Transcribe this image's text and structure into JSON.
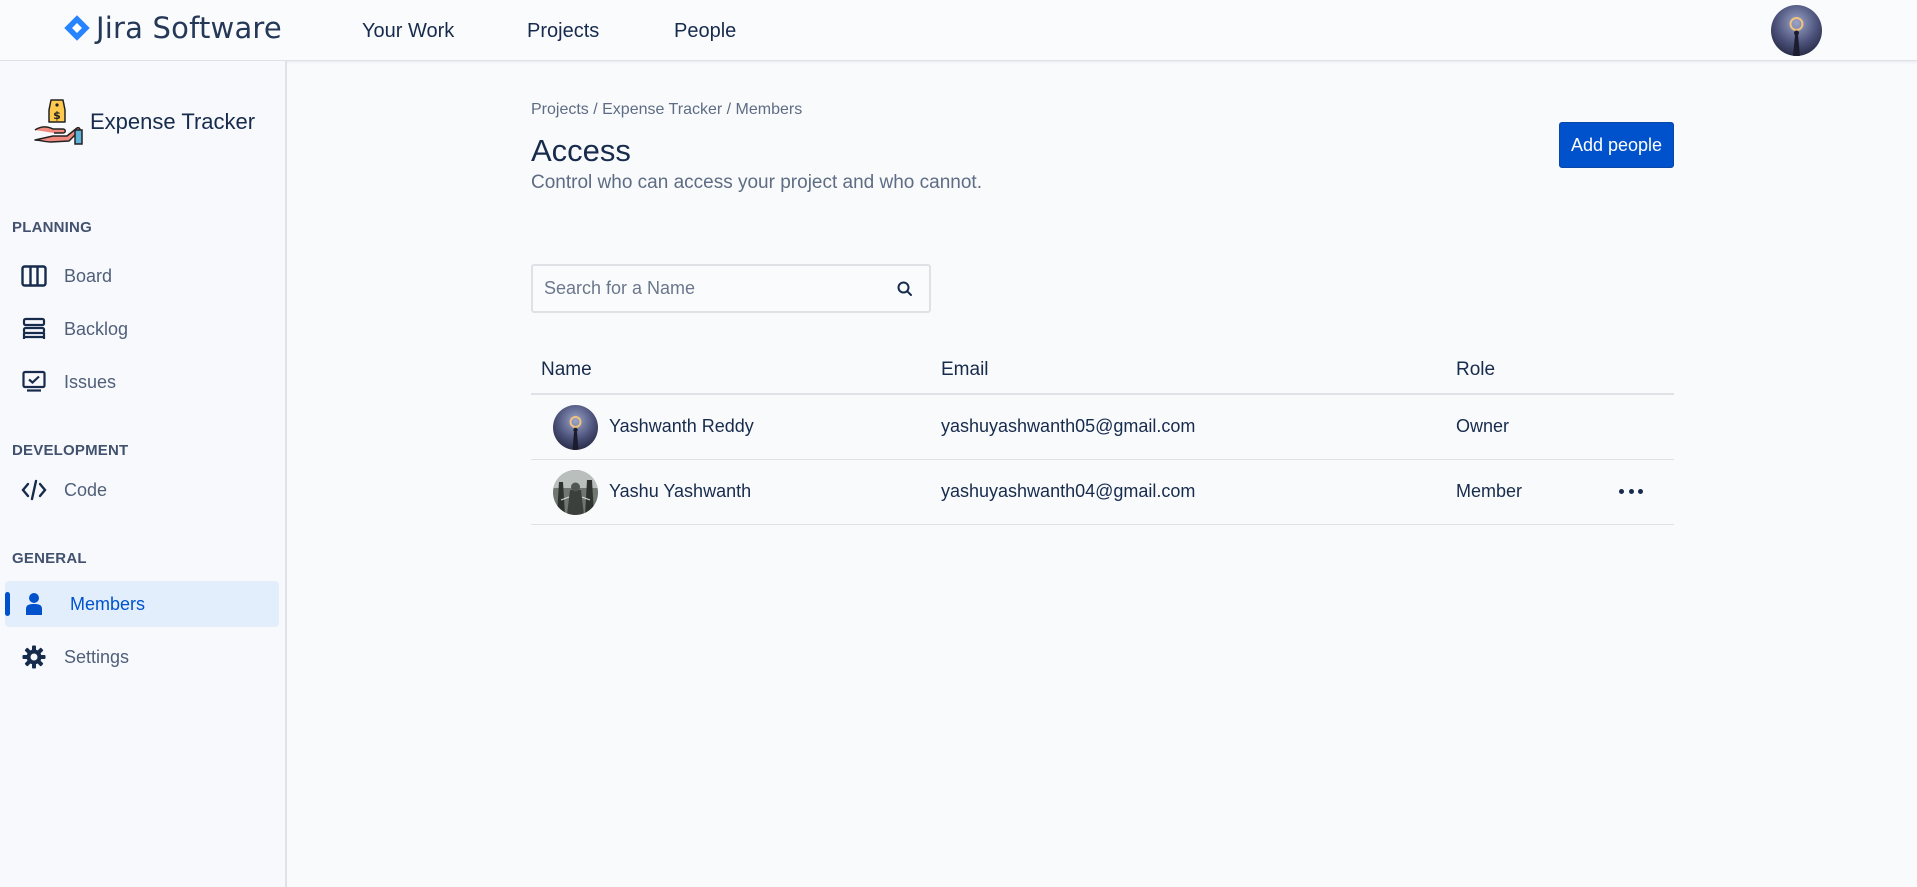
{
  "app": {
    "name": "Jira Software",
    "brand_color": "#2684ff"
  },
  "topnav": {
    "items": [
      {
        "label": "Your Work"
      },
      {
        "label": "Projects"
      },
      {
        "label": "People"
      }
    ],
    "avatar": "user-avatar"
  },
  "sidebar": {
    "project_name": "Expense Tracker",
    "project_icon": "money-hand-icon",
    "sections": [
      {
        "title": "PLANNING",
        "items": [
          {
            "label": "Board",
            "icon": "board-columns-icon"
          },
          {
            "label": "Backlog",
            "icon": "backlog-stack-icon"
          },
          {
            "label": "Issues",
            "icon": "issues-monitor-icon"
          }
        ]
      },
      {
        "title": "DEVELOPMENT",
        "items": [
          {
            "label": "Code",
            "icon": "code-icon"
          }
        ]
      },
      {
        "title": "GENERAL",
        "items": [
          {
            "label": "Members",
            "icon": "person-icon",
            "active": true
          },
          {
            "label": "Settings",
            "icon": "gear-icon"
          }
        ]
      }
    ]
  },
  "main": {
    "breadcrumb": "Projects / Expense Tracker / Members",
    "title": "Access",
    "subtitle": "Control who can access your project and who cannot.",
    "add_button": "Add people",
    "search_placeholder": "Search for a Name",
    "table": {
      "headers": {
        "name": "Name",
        "email": "Email",
        "role": "Role"
      },
      "rows": [
        {
          "name": "Yashwanth Reddy",
          "email": "yashuyashwanth05@gmail.com",
          "role": "Owner"
        },
        {
          "name": "Yashu Yashwanth",
          "email": "yashuyashwanth04@gmail.com",
          "role": "Member"
        }
      ]
    }
  },
  "colors": {
    "primary": "#0052cc",
    "active_bg": "#e3eefd",
    "text": "#172b4d",
    "muted": "#5e6c84"
  }
}
